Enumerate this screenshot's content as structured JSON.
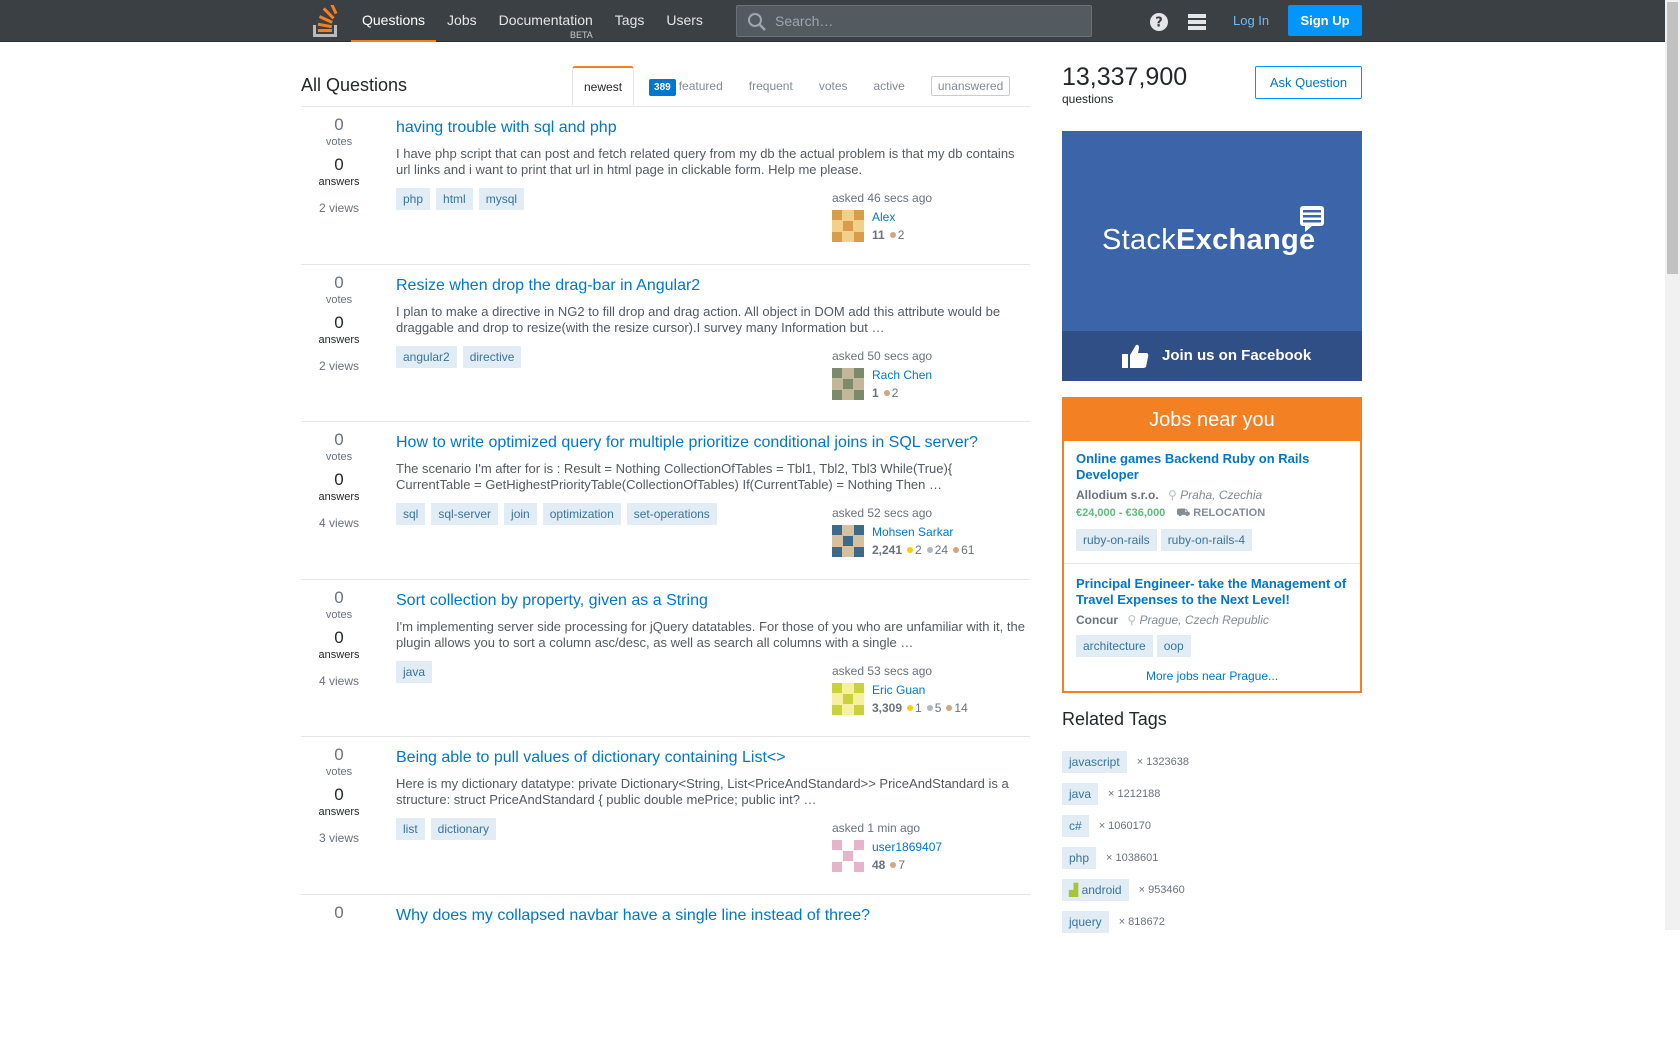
{
  "topbar": {
    "nav": [
      {
        "label": "Questions",
        "active": true
      },
      {
        "label": "Jobs"
      },
      {
        "label": "Documentation",
        "sub": "BETA"
      },
      {
        "label": "Tags"
      },
      {
        "label": "Users"
      }
    ],
    "search_placeholder": "Search…",
    "login_label": "Log In",
    "signup_label": "Sign Up",
    "brand_color": "#f48024",
    "accent_color": "#0095ff"
  },
  "main": {
    "title": "All Questions",
    "tabs": [
      {
        "label": "newest",
        "active": true
      },
      {
        "label": "featured",
        "badge": "389"
      },
      {
        "label": "frequent"
      },
      {
        "label": "votes"
      },
      {
        "label": "active"
      },
      {
        "label": "unanswered"
      }
    ],
    "questions": [
      {
        "votes": "0",
        "votes_label": "votes",
        "answers": "0",
        "answers_label": "answers",
        "views": "2 views",
        "title": "having trouble with sql and php",
        "excerpt": "I have php script that can post and fetch related query from my db the actual problem is that my db contains url links and i want to print that url in html page in clickable form. Help me please.",
        "tags": [
          "php",
          "html",
          "mysql"
        ],
        "asked": "asked 46 secs ago",
        "user": "Alex",
        "rep": "11",
        "badges": [
          {
            "type": "bronze",
            "count": "2"
          }
        ]
      },
      {
        "votes": "0",
        "votes_label": "votes",
        "answers": "0",
        "answers_label": "answers",
        "views": "2 views",
        "title": "Resize when drop the drag-bar in Angular2",
        "excerpt": "I plan to make a directive in NG2 to fill drop and drag action. All object in DOM add this attribute would be draggable and drop to resize(with the resize cursor).I survey many Information but …",
        "tags": [
          "angular2",
          "directive"
        ],
        "asked": "asked 50 secs ago",
        "user": "Rach Chen",
        "rep": "1",
        "badges": [
          {
            "type": "bronze",
            "count": "2"
          }
        ]
      },
      {
        "votes": "0",
        "votes_label": "votes",
        "answers": "0",
        "answers_label": "answers",
        "views": "4 views",
        "title": "How to write optimized query for multiple prioritize conditional joins in SQL server?",
        "excerpt": "The scenario I'm after for is : Result = Nothing CollectionOfTables = Tbl1, Tbl2, Tbl3 While(True){ CurrentTable = GetHighestPriorityTable(CollectionOfTables) If(CurrentTable) = Nothing Then …",
        "tags": [
          "sql",
          "sql-server",
          "join",
          "optimization",
          "set-operations"
        ],
        "asked": "asked 52 secs ago",
        "user": "Mohsen Sarkar",
        "rep": "2,241",
        "badges": [
          {
            "type": "gold",
            "count": "2"
          },
          {
            "type": "silver",
            "count": "24"
          },
          {
            "type": "bronze",
            "count": "61"
          }
        ]
      },
      {
        "votes": "0",
        "votes_label": "votes",
        "answers": "0",
        "answers_label": "answers",
        "views": "4 views",
        "title": "Sort collection by property, given as a String",
        "excerpt": "I'm implementing server side processing for jQuery datatables. For those of you who are unfamiliar with it, the plugin allows you to sort a column asc/desc, as well as search all columns with a single …",
        "tags": [
          "java"
        ],
        "asked": "asked 53 secs ago",
        "user": "Eric Guan",
        "rep": "3,309",
        "badges": [
          {
            "type": "gold",
            "count": "1"
          },
          {
            "type": "silver",
            "count": "5"
          },
          {
            "type": "bronze",
            "count": "14"
          }
        ]
      },
      {
        "votes": "0",
        "votes_label": "votes",
        "answers": "0",
        "answers_label": "answers",
        "views": "3 views",
        "title": "Being able to pull values of dictionary containing List<>",
        "excerpt": "Here is my dictionary datatype: private Dictionary<String, List<PriceAndStandard>> PriceAndStandard is a structure: struct PriceAndStandard { public double mePrice; public int? …",
        "tags": [
          "list",
          "dictionary"
        ],
        "asked": "asked 1 min ago",
        "user": "user1869407",
        "rep": "48",
        "badges": [
          {
            "type": "bronze",
            "count": "7"
          }
        ]
      },
      {
        "votes": "0",
        "votes_label": "",
        "answers": "",
        "answers_label": "",
        "views": "",
        "title": "Why does my collapsed navbar have a single line instead of three?",
        "excerpt": "",
        "tags": [],
        "asked": "",
        "user": "",
        "rep": "",
        "badges": []
      }
    ]
  },
  "sidebar": {
    "question_count": "13,337,900",
    "question_count_label": "questions",
    "ask_button": "Ask Question",
    "ad": {
      "brand_light": "Stack",
      "brand_bold": "Exchange",
      "cta": "Join us on Facebook"
    },
    "jobs": {
      "heading": "Jobs near you",
      "listings": [
        {
          "title": "Online games Backend Ruby on Rails Developer",
          "company": "Allodium s.r.o.",
          "location": "Praha, Czechia",
          "salary": "€24,000 - €36,000",
          "relocation": "RELOCATION",
          "tags": [
            "ruby-on-rails",
            "ruby-on-rails-4"
          ]
        },
        {
          "title": "Principal Engineer- take the Management of Travel Expenses to the Next Level!",
          "company": "Concur",
          "location": "Prague, Czech Republic",
          "salary": "",
          "relocation": "",
          "tags": [
            "architecture",
            "oop"
          ]
        }
      ],
      "more": "More jobs near Prague..."
    },
    "related_tags_title": "Related Tags",
    "related_tags": [
      {
        "name": "javascript",
        "count": "× 1323638"
      },
      {
        "name": "java",
        "count": "× 1212188"
      },
      {
        "name": "c#",
        "count": "× 1060170"
      },
      {
        "name": "php",
        "count": "× 1038601"
      },
      {
        "name": "android",
        "count": "× 953460"
      },
      {
        "name": "jquery",
        "count": "× 818672"
      }
    ]
  }
}
